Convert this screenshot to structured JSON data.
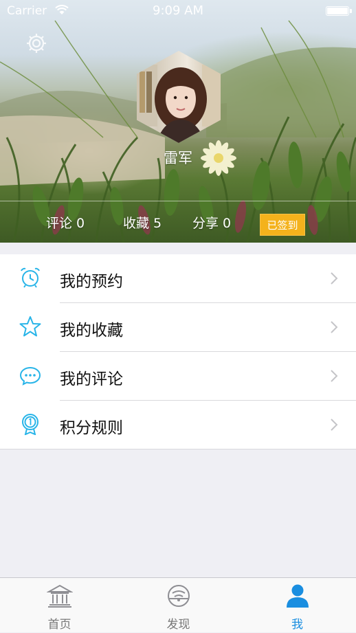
{
  "status_bar": {
    "carrier": "Carrier",
    "time": "9:09 AM"
  },
  "profile": {
    "username": "雷军",
    "stats": [
      {
        "label": "评论",
        "count": "0"
      },
      {
        "label": "收藏",
        "count": "5"
      },
      {
        "label": "分享",
        "count": "0"
      }
    ],
    "checkin_label": "已签到"
  },
  "menu": {
    "items": [
      {
        "label": "我的预约",
        "icon": "alarm-clock-icon"
      },
      {
        "label": "我的收藏",
        "icon": "star-icon"
      },
      {
        "label": "我的评论",
        "icon": "chat-bubble-icon"
      },
      {
        "label": "积分规则",
        "icon": "medal-icon"
      }
    ]
  },
  "tabbar": {
    "tabs": [
      {
        "label": "首页",
        "icon": "museum-icon"
      },
      {
        "label": "发现",
        "icon": "discover-icon"
      },
      {
        "label": "我",
        "icon": "person-icon"
      }
    ],
    "active_index": 2
  },
  "colors": {
    "accent": "#1a8ee0",
    "icon_tint": "#27b4e8",
    "checkin_badge": "#f4b21c",
    "background": "#efeff4"
  }
}
